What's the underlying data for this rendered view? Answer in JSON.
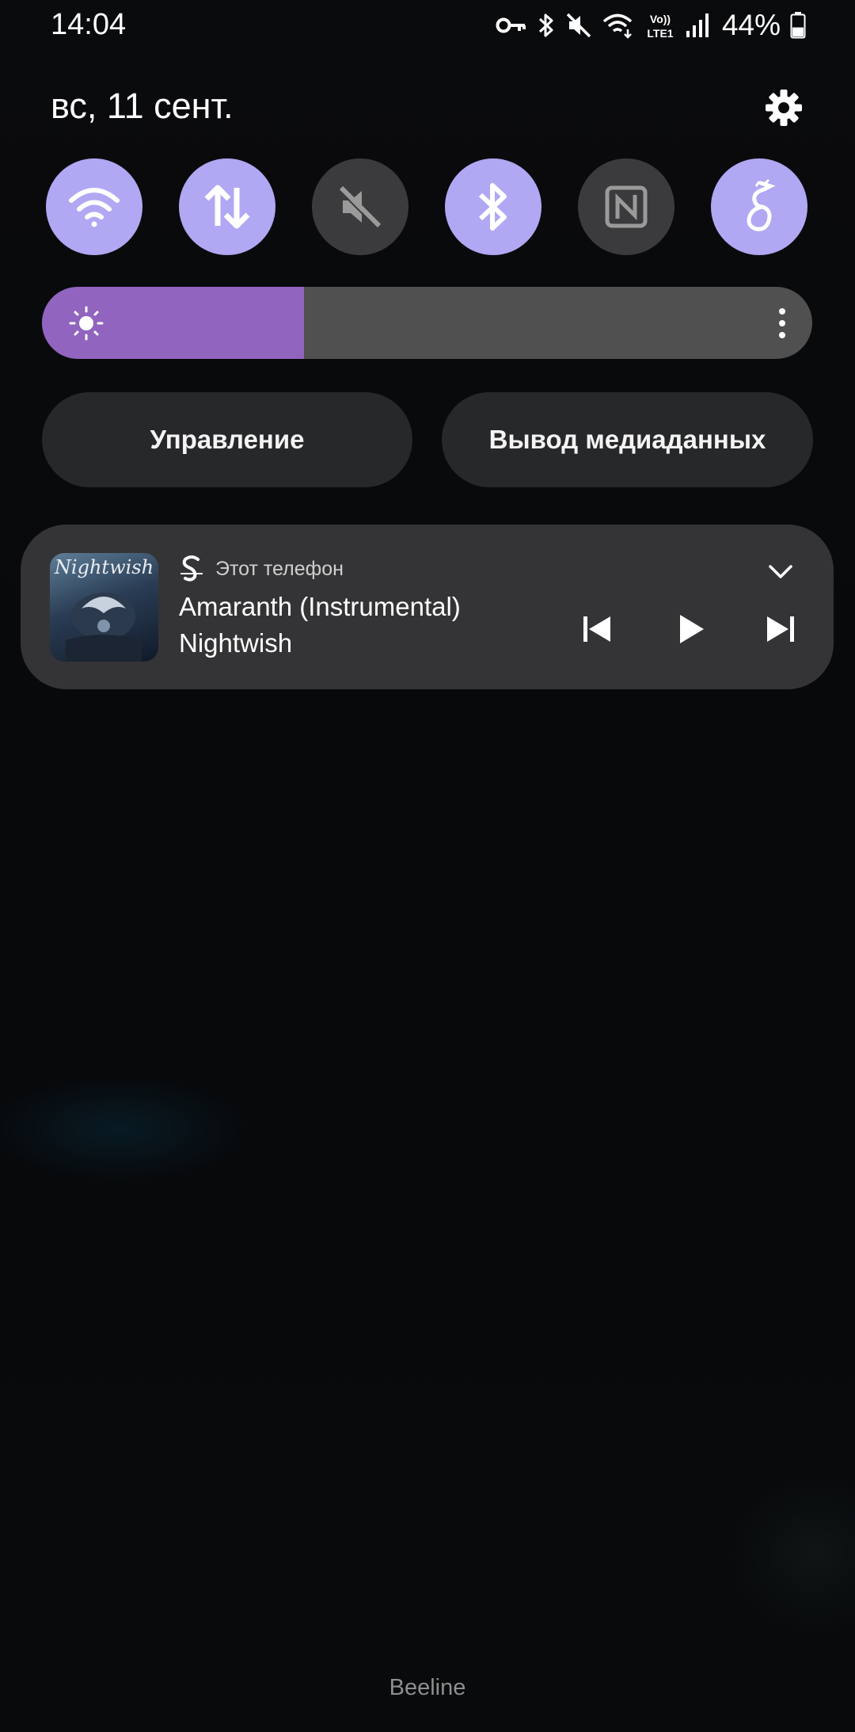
{
  "status_bar": {
    "time": "14:04",
    "icons": [
      "vpn-key-icon",
      "bluetooth-icon",
      "mute-icon",
      "wifi-calling-icon",
      "volte-lte-icon",
      "signal-icon",
      "battery-icon"
    ],
    "volte_line1": "Vo))",
    "volte_line2": "LTE1",
    "battery_percent": "44%",
    "battery_level": 0.44
  },
  "header": {
    "date": "вс, 11 сент.",
    "settings_icon": "gear-icon"
  },
  "quick_toggles": [
    {
      "icon": "wifi-icon",
      "active": true
    },
    {
      "icon": "mobile-data-icon",
      "active": true
    },
    {
      "icon": "sound-mute-icon",
      "active": false
    },
    {
      "icon": "bluetooth-icon",
      "active": true
    },
    {
      "icon": "nfc-icon",
      "active": false
    },
    {
      "icon": "dragon-app-icon",
      "active": true
    }
  ],
  "brightness": {
    "level_fraction": 0.34,
    "fill_color": "#9164bf"
  },
  "buttons": {
    "control_label": "Управление",
    "media_output_label": "Вывод медиаданных"
  },
  "media": {
    "album_art_text": "Nightwish",
    "source_label": "Этот телефон",
    "title": "Amaranth (Instrumental)",
    "artist": "Nightwish"
  },
  "colors": {
    "toggle_active": "#b0a8f3",
    "toggle_inactive": "#3b3b3d",
    "card_bg": "#343436"
  },
  "carrier": "Beeline"
}
